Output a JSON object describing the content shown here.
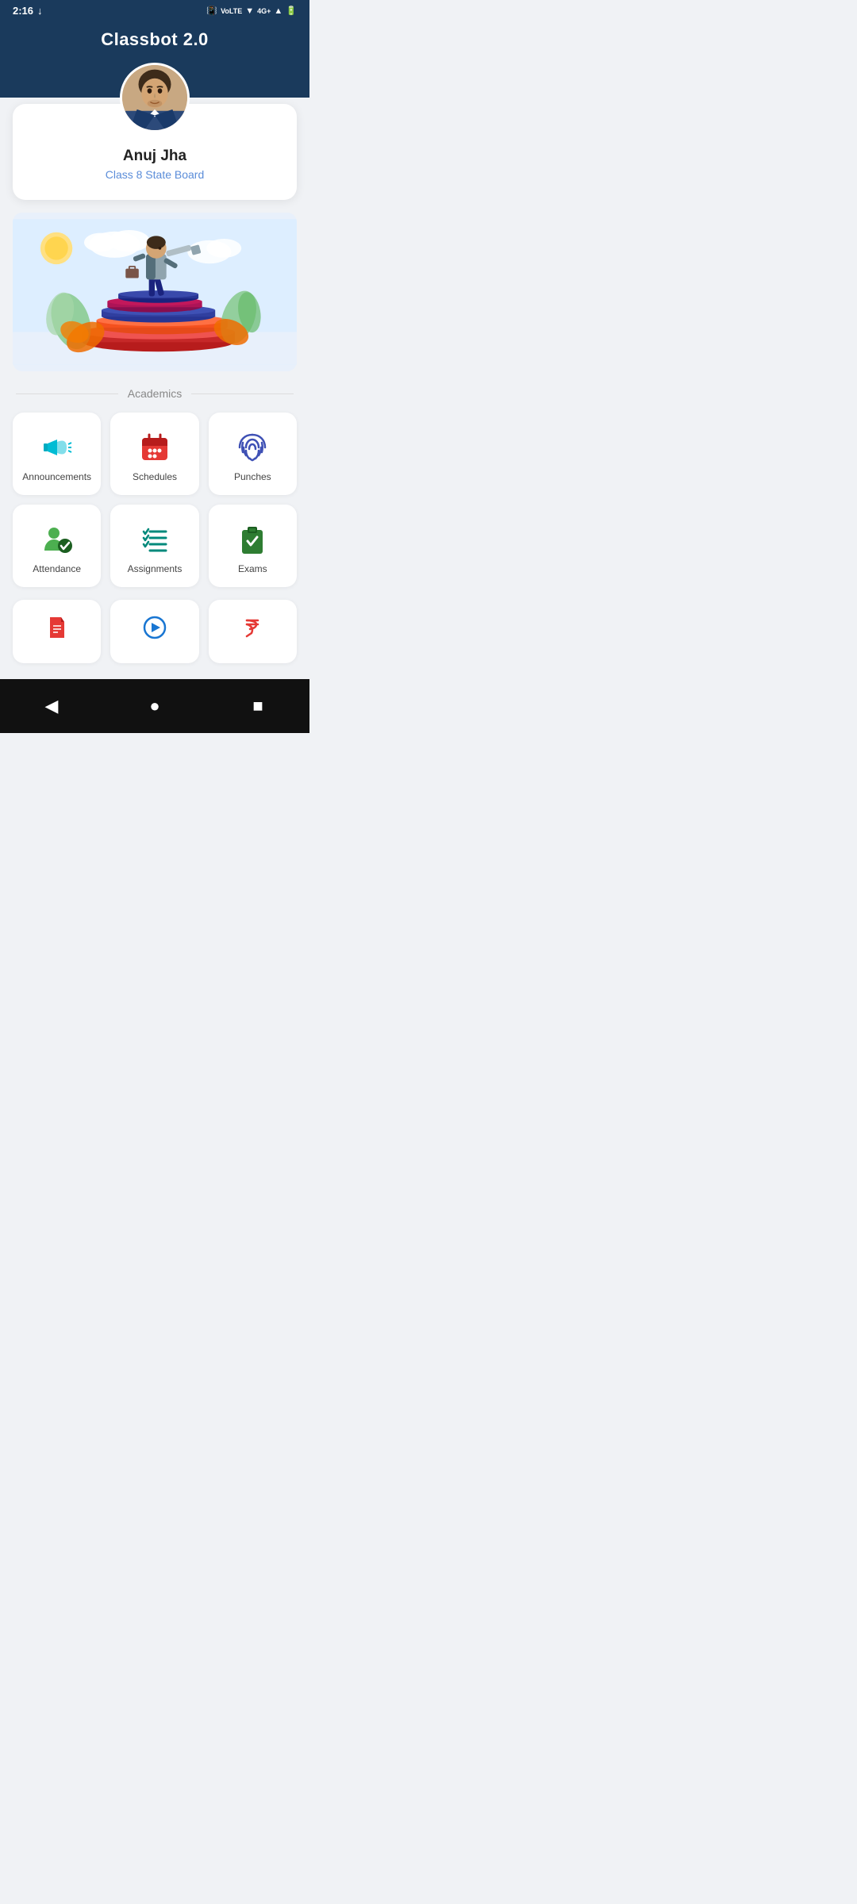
{
  "statusBar": {
    "time": "2:16",
    "downloadIcon": "↓"
  },
  "header": {
    "title": "Classbot 2.0"
  },
  "profile": {
    "name": "Anuj Jha",
    "class": "Class 8 State Board"
  },
  "sectionLabel": "Academics",
  "grid": [
    {
      "id": "announcements",
      "label": "Announcements",
      "iconColor": "#00bcd4",
      "iconType": "megaphone"
    },
    {
      "id": "schedules",
      "label": "Schedules",
      "iconColor": "#e53935",
      "iconType": "calendar"
    },
    {
      "id": "punches",
      "label": "Punches",
      "iconColor": "#3f51b5",
      "iconType": "fingerprint"
    },
    {
      "id": "attendance",
      "label": "Attendance",
      "iconColor": "#4caf50",
      "iconType": "person-check"
    },
    {
      "id": "assignments",
      "label": "Assignments",
      "iconColor": "#00897b",
      "iconType": "list-check"
    },
    {
      "id": "exams",
      "label": "Exams",
      "iconColor": "#2e7d32",
      "iconType": "clipboard-check"
    }
  ],
  "partialGrid": [
    {
      "id": "notes",
      "label": "",
      "iconColor": "#e53935",
      "iconType": "document"
    },
    {
      "id": "videos",
      "label": "",
      "iconColor": "#1976d2",
      "iconType": "play"
    },
    {
      "id": "fees",
      "label": "",
      "iconColor": "#e53935",
      "iconType": "rupee"
    }
  ],
  "nav": {
    "back": "◀",
    "home": "●",
    "recent": "■"
  }
}
